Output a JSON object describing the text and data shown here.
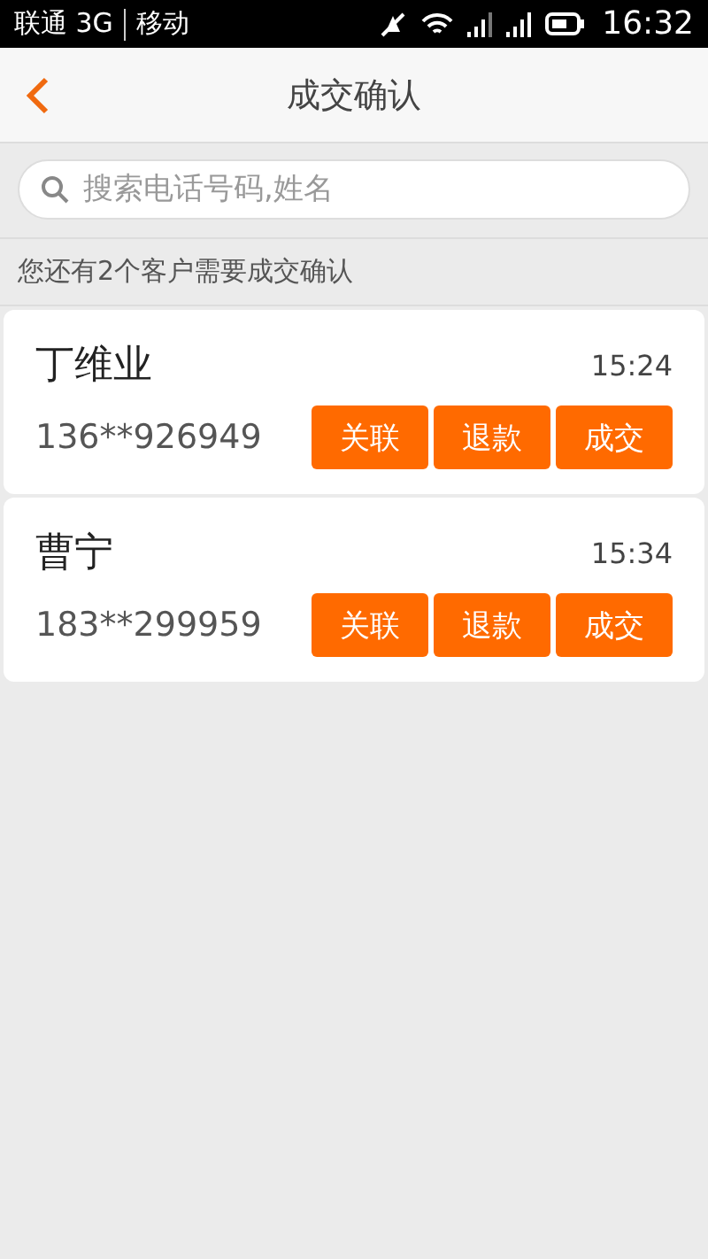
{
  "status_bar": {
    "carrier_1": "联通 3G",
    "carrier_2": "移动",
    "time": "16:32"
  },
  "header": {
    "title": "成交确认"
  },
  "search": {
    "placeholder": "搜索电话号码,姓名"
  },
  "summary": "您还有2个客户需要成交确认",
  "customers": [
    {
      "name": "丁维业",
      "time": "15:24",
      "phone": "136**926949",
      "actions": [
        "关联",
        "退款",
        "成交"
      ]
    },
    {
      "name": "曹宁",
      "time": "15:34",
      "phone": "183**299959",
      "actions": [
        "关联",
        "退款",
        "成交"
      ]
    }
  ]
}
